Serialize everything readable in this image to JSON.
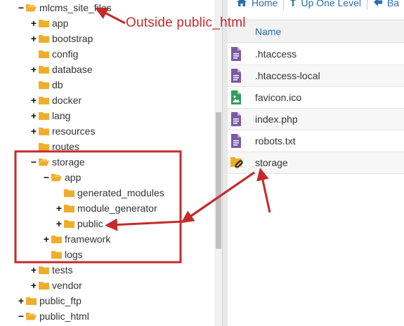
{
  "tree": {
    "items": [
      {
        "label": "mlcms_site_files",
        "toggle": "−",
        "open": true
      },
      {
        "label": "app",
        "toggle": "+"
      },
      {
        "label": "bootstrap",
        "toggle": "+"
      },
      {
        "label": "config",
        "toggle": ""
      },
      {
        "label": "database",
        "toggle": "+"
      },
      {
        "label": "db",
        "toggle": ""
      },
      {
        "label": "docker",
        "toggle": "+"
      },
      {
        "label": "lang",
        "toggle": "+"
      },
      {
        "label": "resources",
        "toggle": "+"
      },
      {
        "label": "routes",
        "toggle": ""
      },
      {
        "label": "storage",
        "toggle": "−",
        "open": true
      },
      {
        "label": "app",
        "toggle": "−",
        "open": true
      },
      {
        "label": "generated_modules",
        "toggle": ""
      },
      {
        "label": "module_generator",
        "toggle": "+"
      },
      {
        "label": "public",
        "toggle": "+"
      },
      {
        "label": "framework",
        "toggle": "+"
      },
      {
        "label": "logs",
        "toggle": ""
      },
      {
        "label": "tests",
        "toggle": "+"
      },
      {
        "label": "vendor",
        "toggle": "+"
      },
      {
        "label": "public_ftp",
        "toggle": "+"
      },
      {
        "label": "public_html",
        "toggle": "−",
        "open": true
      }
    ]
  },
  "toolbar": {
    "home_label": "Home",
    "up_label": "Up One Level",
    "back_label": "Ba"
  },
  "list": {
    "header_name": "Name",
    "files": [
      {
        "name": ".htaccess",
        "icon": "text-file-icon"
      },
      {
        "name": ".htaccess-local",
        "icon": "text-file-icon"
      },
      {
        "name": "favicon.ico",
        "icon": "image-file-icon"
      },
      {
        "name": "index.php",
        "icon": "text-file-icon"
      },
      {
        "name": "robots.txt",
        "icon": "text-file-icon"
      },
      {
        "name": "storage",
        "icon": "folder-symlink-icon"
      }
    ]
  },
  "annotations": {
    "outside_label": "Outside public_html",
    "color": "#c42b2b"
  },
  "colors": {
    "folder": "#f0ad2c",
    "text_file": "#7b5aa6",
    "image_file": "#2f9e5a",
    "link": "#2a6db0"
  }
}
